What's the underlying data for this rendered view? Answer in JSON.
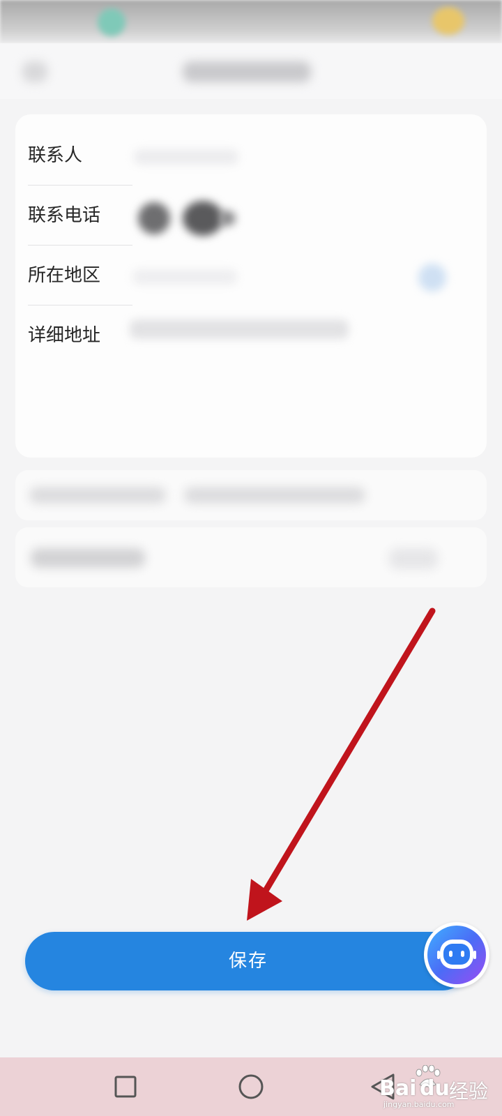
{
  "form": {
    "rows": [
      {
        "label": "联系人"
      },
      {
        "label": "联系电话"
      },
      {
        "label": "所在地区"
      },
      {
        "label": "详细地址"
      }
    ]
  },
  "actions": {
    "save_label": "保存"
  },
  "nav": {
    "buttons": [
      "recent-apps",
      "home",
      "back"
    ]
  },
  "watermark": {
    "brand_a": "Bai",
    "brand_b": "du",
    "suffix": "经验",
    "url": "jingyan.baidu.com"
  },
  "colors": {
    "primary": "#2585e0",
    "annotation_arrow": "#c0141c",
    "nav_bar": "#ecd2d6"
  }
}
